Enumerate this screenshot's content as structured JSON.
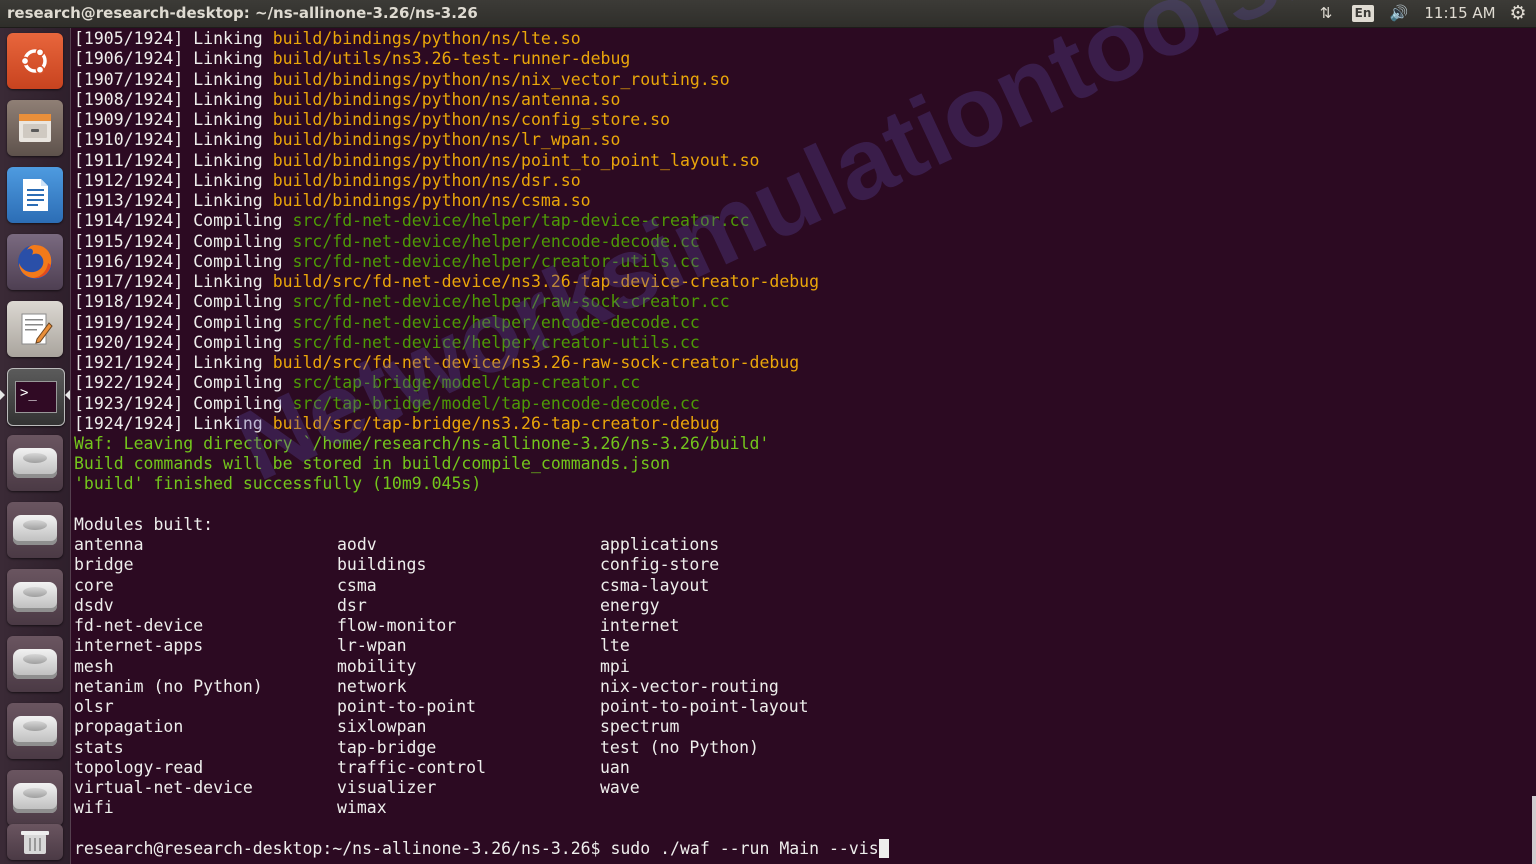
{
  "window": {
    "title": "research@research-desktop: ~/ns-allinone-3.26/ns-3.26"
  },
  "indicators": {
    "network_icon": "⇅",
    "keyboard_lang": "En",
    "sound_icon": "🔊",
    "clock": "11:15 AM",
    "settings_icon": "⚙"
  },
  "launcher": {
    "items": [
      {
        "name": "ubuntu-dash",
        "icon": "ubuntu-logo-icon"
      },
      {
        "name": "files",
        "icon": "file-cabinet-icon"
      },
      {
        "name": "libreoffice-writer",
        "icon": "writer-document-icon"
      },
      {
        "name": "firefox",
        "icon": "firefox-icon"
      },
      {
        "name": "text-editor",
        "icon": "text-editor-icon"
      },
      {
        "name": "terminal",
        "icon": "terminal-icon",
        "prompt_glyph": ">_"
      },
      {
        "name": "drive-1",
        "icon": "hard-drive-icon"
      },
      {
        "name": "drive-2",
        "icon": "hard-drive-icon"
      },
      {
        "name": "drive-3",
        "icon": "hard-drive-icon"
      },
      {
        "name": "drive-4",
        "icon": "hard-drive-icon"
      },
      {
        "name": "drive-5",
        "icon": "hard-drive-icon"
      },
      {
        "name": "drive-6",
        "icon": "hard-drive-icon"
      },
      {
        "name": "trash",
        "icon": "trash-icon"
      }
    ]
  },
  "terminal": {
    "build_lines": [
      {
        "prefix": "[1905/1924] Linking ",
        "target": "build/bindings/python/ns/lte.so",
        "kind": "link"
      },
      {
        "prefix": "[1906/1924] Linking ",
        "target": "build/utils/ns3.26-test-runner-debug",
        "kind": "link"
      },
      {
        "prefix": "[1907/1924] Linking ",
        "target": "build/bindings/python/ns/nix_vector_routing.so",
        "kind": "link"
      },
      {
        "prefix": "[1908/1924] Linking ",
        "target": "build/bindings/python/ns/antenna.so",
        "kind": "link"
      },
      {
        "prefix": "[1909/1924] Linking ",
        "target": "build/bindings/python/ns/config_store.so",
        "kind": "link"
      },
      {
        "prefix": "[1910/1924] Linking ",
        "target": "build/bindings/python/ns/lr_wpan.so",
        "kind": "link"
      },
      {
        "prefix": "[1911/1924] Linking ",
        "target": "build/bindings/python/ns/point_to_point_layout.so",
        "kind": "link"
      },
      {
        "prefix": "[1912/1924] Linking ",
        "target": "build/bindings/python/ns/dsr.so",
        "kind": "link"
      },
      {
        "prefix": "[1913/1924] Linking ",
        "target": "build/bindings/python/ns/csma.so",
        "kind": "link"
      },
      {
        "prefix": "[1914/1924] Compiling ",
        "target": "src/fd-net-device/helper/tap-device-creator.cc",
        "kind": "compile"
      },
      {
        "prefix": "[1915/1924] Compiling ",
        "target": "src/fd-net-device/helper/encode-decode.cc",
        "kind": "compile"
      },
      {
        "prefix": "[1916/1924] Compiling ",
        "target": "src/fd-net-device/helper/creator-utils.cc",
        "kind": "compile"
      },
      {
        "prefix": "[1917/1924] Linking ",
        "target": "build/src/fd-net-device/ns3.26-tap-device-creator-debug",
        "kind": "link"
      },
      {
        "prefix": "[1918/1924] Compiling ",
        "target": "src/fd-net-device/helper/raw-sock-creator.cc",
        "kind": "compile"
      },
      {
        "prefix": "[1919/1924] Compiling ",
        "target": "src/fd-net-device/helper/encode-decode.cc",
        "kind": "compile"
      },
      {
        "prefix": "[1920/1924] Compiling ",
        "target": "src/fd-net-device/helper/creator-utils.cc",
        "kind": "compile"
      },
      {
        "prefix": "[1921/1924] Linking ",
        "target": "build/src/fd-net-device/ns3.26-raw-sock-creator-debug",
        "kind": "link"
      },
      {
        "prefix": "[1922/1924] Compiling ",
        "target": "src/tap-bridge/model/tap-creator.cc",
        "kind": "compile"
      },
      {
        "prefix": "[1923/1924] Compiling ",
        "target": "src/tap-bridge/model/tap-encode-decode.cc",
        "kind": "compile"
      },
      {
        "prefix": "[1924/1924] Linking ",
        "target": "build/src/tap-bridge/ns3.26-tap-creator-debug",
        "kind": "link"
      }
    ],
    "status_lines": [
      "Waf: Leaving directory `/home/research/ns-allinone-3.26/ns-3.26/build'",
      "Build commands will be stored in build/compile_commands.json",
      "'build' finished successfully (10m9.045s)"
    ],
    "modules_header": "Modules built:",
    "modules": [
      [
        "antenna",
        "aodv",
        "applications"
      ],
      [
        "bridge",
        "buildings",
        "config-store"
      ],
      [
        "core",
        "csma",
        "csma-layout"
      ],
      [
        "dsdv",
        "dsr",
        "energy"
      ],
      [
        "fd-net-device",
        "flow-monitor",
        "internet"
      ],
      [
        "internet-apps",
        "lr-wpan",
        "lte"
      ],
      [
        "mesh",
        "mobility",
        "mpi"
      ],
      [
        "netanim (no Python)",
        "network",
        "nix-vector-routing"
      ],
      [
        "olsr",
        "point-to-point",
        "point-to-point-layout"
      ],
      [
        "propagation",
        "sixlowpan",
        "spectrum"
      ],
      [
        "stats",
        "tap-bridge",
        "test (no Python)"
      ],
      [
        "topology-read",
        "traffic-control",
        "uan"
      ],
      [
        "virtual-net-device",
        "visualizer",
        "wave"
      ],
      [
        "wifi",
        "wimax",
        ""
      ]
    ],
    "prompt": "research@research-desktop:~/ns-allinone-3.26/ns-3.26$ ",
    "command": "sudo ./waf --run Main --vis"
  },
  "watermark": "Networksimulationtools.com",
  "colors": {
    "background": "#2c0a22",
    "link": "#eaa60a",
    "compile": "#4e9a06",
    "status": "#73c51c",
    "text": "#eeeeec"
  }
}
